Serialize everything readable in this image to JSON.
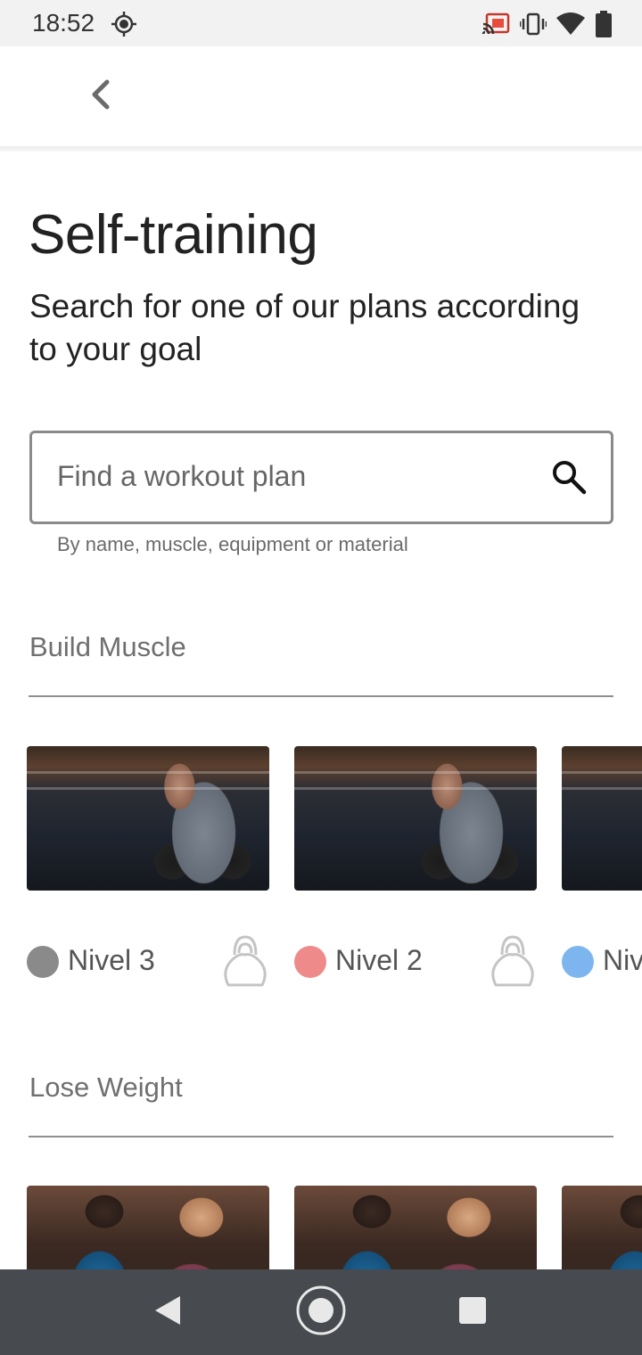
{
  "status_bar": {
    "time": "18:52",
    "icons": [
      "location-target-icon",
      "cast-icon",
      "vibrate-icon",
      "wifi-icon",
      "battery-icon"
    ]
  },
  "app_bar": {
    "back_icon": "chevron-left-icon"
  },
  "page": {
    "title": "Self-training",
    "subtitle": "Search for one of our plans according to your goal"
  },
  "search": {
    "placeholder": "Find a workout plan",
    "value": "",
    "hint": "By name, muscle, equipment or material",
    "icon": "search-icon"
  },
  "sections": [
    {
      "title": "Build Muscle",
      "cards": [
        {
          "level": "Nivel 3",
          "dot_color": "#8a8a8a",
          "icon": "kettlebell-icon"
        },
        {
          "level": "Nivel 2",
          "dot_color": "#ee8a8a",
          "icon": "kettlebell-icon"
        },
        {
          "level": "Niv",
          "dot_color": "#7db6ee",
          "icon": "kettlebell-icon"
        }
      ]
    },
    {
      "title": "Lose Weight",
      "cards": [
        {
          "level": "",
          "dot_color": "",
          "icon": ""
        },
        {
          "level": "",
          "dot_color": "",
          "icon": ""
        },
        {
          "level": "",
          "dot_color": "",
          "icon": ""
        }
      ]
    }
  ],
  "nav_bar": {
    "icons": [
      "nav-back-icon",
      "nav-home-icon",
      "nav-recents-icon"
    ]
  },
  "colors": {
    "status_bar_bg": "#f2f2f2",
    "nav_bar_bg": "#474a4f",
    "divider": "#8f8f8f",
    "section_title": "#6f6f6f"
  }
}
